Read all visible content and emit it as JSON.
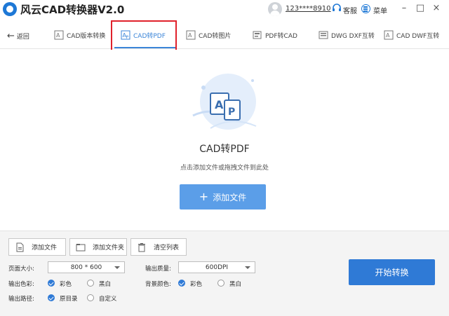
{
  "window": {
    "title": "风云CAD转换器V2.0",
    "user": "123****8910",
    "service_label": "客服",
    "menu_label": "菜单",
    "minimize": "–",
    "maximize": "□",
    "close": "×"
  },
  "nav": {
    "back_label": "返回",
    "tabs": [
      {
        "label": "CAD版本转换",
        "icon": "cad-version-icon"
      },
      {
        "label": "CAD转PDF",
        "icon": "cad-to-pdf-icon",
        "active": true
      },
      {
        "label": "CAD转图片",
        "icon": "cad-to-image-icon"
      },
      {
        "label": "PDF转CAD",
        "icon": "pdf-to-cad-icon"
      },
      {
        "label": "DWG DXF互转",
        "icon": "dwg-dxf-icon"
      },
      {
        "label": "CAD DWF互转",
        "icon": "cad-dwf-icon"
      }
    ]
  },
  "main": {
    "title": "CAD转PDF",
    "hint": "点击添加文件或拖拽文件到此处",
    "add_button": "添加文件",
    "add_plus": "+"
  },
  "toolbar": {
    "add_file": "添加文件",
    "add_folder": "添加文件夹",
    "clear_list": "清空列表"
  },
  "options": {
    "page_size_label": "页面大小:",
    "page_size_value": "800 * 600",
    "output_quality_label": "输出质量:",
    "output_quality_value": "600DPI",
    "output_color_label": "输出色彩:",
    "output_color_options": [
      "彩色",
      "黑白"
    ],
    "bg_color_label": "背景颜色:",
    "bg_color_options": [
      "彩色",
      "黑白"
    ],
    "output_path_label": "输出路径:",
    "output_path_options": [
      "原目录",
      "自定义"
    ]
  },
  "start_button": "开始转换",
  "colors": {
    "accent": "#3b85d8",
    "primary_button": "#2f7ad6",
    "highlight_border": "#e0212b"
  }
}
